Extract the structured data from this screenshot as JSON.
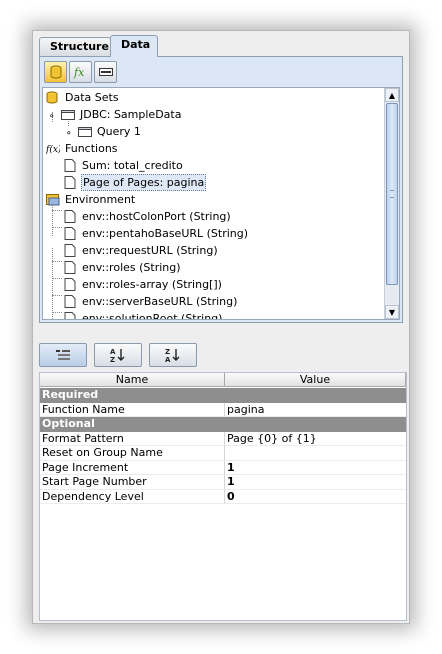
{
  "tabs": [
    {
      "label": "Structure",
      "active": false
    },
    {
      "label": "Data",
      "active": true
    }
  ],
  "toolbar": {
    "icons": [
      "database-icon",
      "function-icon",
      "environment-icon"
    ]
  },
  "tree": {
    "data_sets": "Data Sets",
    "jdbc": "JDBC: SampleData",
    "query": "Query 1",
    "functions": "Functions",
    "function_items": [
      "Sum: total_credito",
      "Page of Pages: pagina"
    ],
    "environment": "Environment",
    "env_items": [
      "env::hostColonPort (String)",
      "env::pentahoBaseURL (String)",
      "env::requestURL (String)",
      "env::roles (String)",
      "env::roles-array (String[])",
      "env::serverBaseURL (String)",
      "env::solutionRoot (String)"
    ],
    "selected": "Page of Pages: pagina"
  },
  "sort_buttons": [
    "categorized",
    "sort-ascending",
    "sort-descending"
  ],
  "properties": {
    "header": {
      "name": "Name",
      "value": "Value"
    },
    "required_label": "Required",
    "optional_label": "Optional",
    "rows": [
      {
        "name": "Function Name",
        "value": "pagina",
        "group": "required"
      },
      {
        "name": "Format Pattern",
        "value": "Page {0} of {1}",
        "group": "optional"
      },
      {
        "name": "Reset on Group Name",
        "value": "",
        "group": "optional"
      },
      {
        "name": "Page Increment",
        "value": "1",
        "group": "optional",
        "bold": true
      },
      {
        "name": "Start Page Number",
        "value": "1",
        "group": "optional",
        "bold": true
      },
      {
        "name": "Dependency Level",
        "value": "0",
        "group": "optional",
        "bold": true
      }
    ]
  },
  "colors": {
    "selection": "#dfe8f6",
    "group_header": "#8e8e8e",
    "panel_bg": "#dce7f5"
  }
}
